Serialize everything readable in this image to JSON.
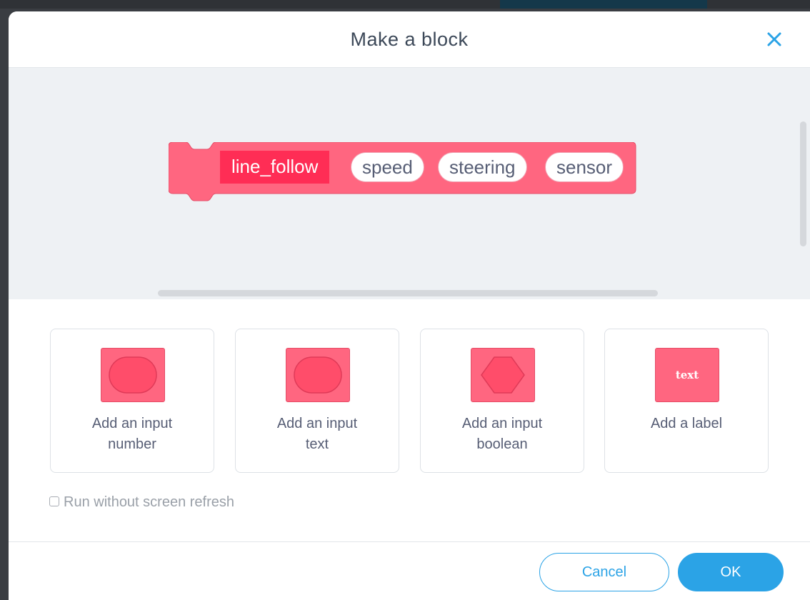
{
  "dialog": {
    "title": "Make a block"
  },
  "block": {
    "name": "line_follow",
    "inputs": [
      "speed",
      "steering",
      "sensor"
    ]
  },
  "options": [
    {
      "line1": "Add an input",
      "line2": "number",
      "icon": "rounded-input-icon"
    },
    {
      "line1": "Add an input",
      "line2": "text",
      "icon": "rounded-input-icon"
    },
    {
      "line1": "Add an input",
      "line2": "boolean",
      "icon": "hexagon-input-icon"
    },
    {
      "line1": "Add a label",
      "line2": "",
      "icon": "label-icon",
      "icon_text": "text"
    }
  ],
  "run_without_refresh": {
    "label": "Run without screen refresh",
    "checked": false
  },
  "buttons": {
    "cancel": "Cancel",
    "ok": "OK"
  },
  "colors": {
    "block": "#ff6680",
    "block_name_bg": "#ff2d55",
    "accent": "#2ba3e6"
  }
}
